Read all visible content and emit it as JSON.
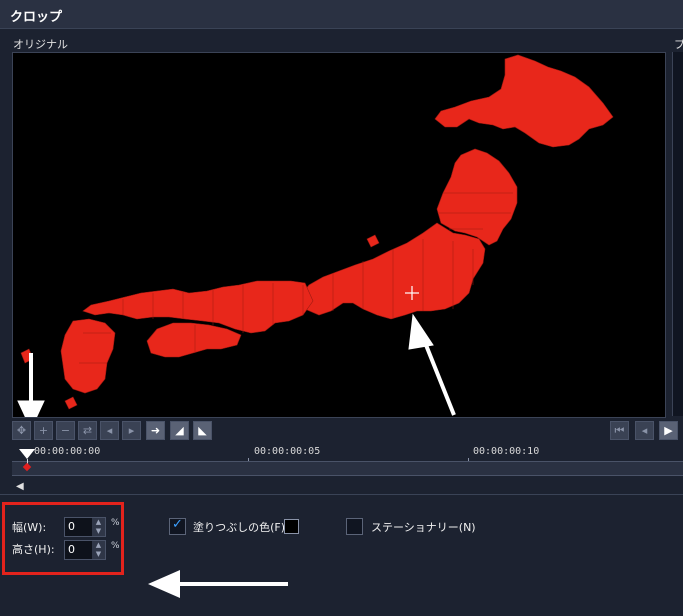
{
  "window": {
    "title": "クロップ"
  },
  "panels": {
    "original_label": "オリジナル",
    "preview_label": "プ"
  },
  "toolbar": {
    "buttons": [
      {
        "icon": "move-left-icon"
      },
      {
        "icon": "add-keyframe-icon"
      },
      {
        "icon": "remove-keyframe-icon"
      },
      {
        "icon": "reverse-icon"
      },
      {
        "icon": "prev-keyframe-icon"
      },
      {
        "icon": "next-keyframe-icon"
      },
      {
        "icon": "move-right-icon"
      },
      {
        "icon": "ease-in-icon"
      },
      {
        "icon": "ease-out-icon"
      }
    ],
    "playback": [
      {
        "icon": "go-start-icon"
      },
      {
        "icon": "prev-frame-icon"
      },
      {
        "icon": "play-icon"
      }
    ]
  },
  "timeline": {
    "timecodes": [
      "00:00:00:00",
      "00:00:00:05",
      "00:00:00:10"
    ]
  },
  "controls": {
    "width_label": "幅(W):",
    "width_value": "0",
    "height_label": "高さ(H):",
    "height_value": "0",
    "unit": "%",
    "fill_color_label": "塗りつぶしの色(F)",
    "fill_color_checked": true,
    "fill_color": "#000000",
    "stationary_label": "ステーショナリー(N)",
    "stationary_checked": false
  },
  "colors": {
    "map_fill": "#e8271b",
    "highlight": "#e3231c"
  }
}
